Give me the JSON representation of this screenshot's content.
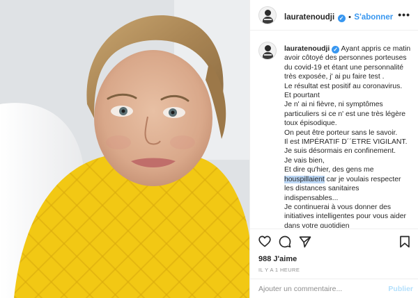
{
  "post": {
    "username": "lauratenoudji",
    "separator": "•",
    "follow_label": "S'abonner",
    "more_label": "•••"
  },
  "caption": {
    "username": "lauratenoudji",
    "first_line": "Ayant appris ce matin",
    "lines": [
      "avoir côtoyé des personnes porteuses",
      "du covid-19 et étant une personnalité",
      "très exposée, j' ai pu faire test .",
      "Le résultat est positif au coronavirus.",
      "Et pourtant",
      "Je n' ai ni fièvre, ni symptômes",
      "particuliers si ce n' est une très légère",
      "toux épisodique.",
      "On peut être porteur sans le savoir.",
      "Il est IMPÉRATIF D´´ETRE VIGILANT.",
      "Je suis désormais en confinement.",
      "Je vais bien,",
      "Et dire qu'hier, des gens me"
    ],
    "highlight_word": "houspillaient",
    "highlight_rest": " car je voulais respecter",
    "lines_after": [
      "les distances sanitaires",
      "indispensables...",
      "Je continuerai à vous donner des",
      "initiatives intelligentes pour vous aider",
      "dans votre quotidien"
    ]
  },
  "actions": {
    "likes": "988 J'aime",
    "time": "IL Y A 1 HEURE",
    "comment_placeholder": "Ajouter un commentaire...",
    "publish_label": "Publier"
  },
  "colors": {
    "accent": "#3897f0",
    "publish_disabled": "#b2dffc",
    "sweater": "#f2c814",
    "highlight": "#bcd7f5"
  },
  "icons": [
    "heart-icon",
    "comment-icon",
    "share-icon",
    "bookmark-icon",
    "verified-badge-icon",
    "more-options-icon"
  ]
}
